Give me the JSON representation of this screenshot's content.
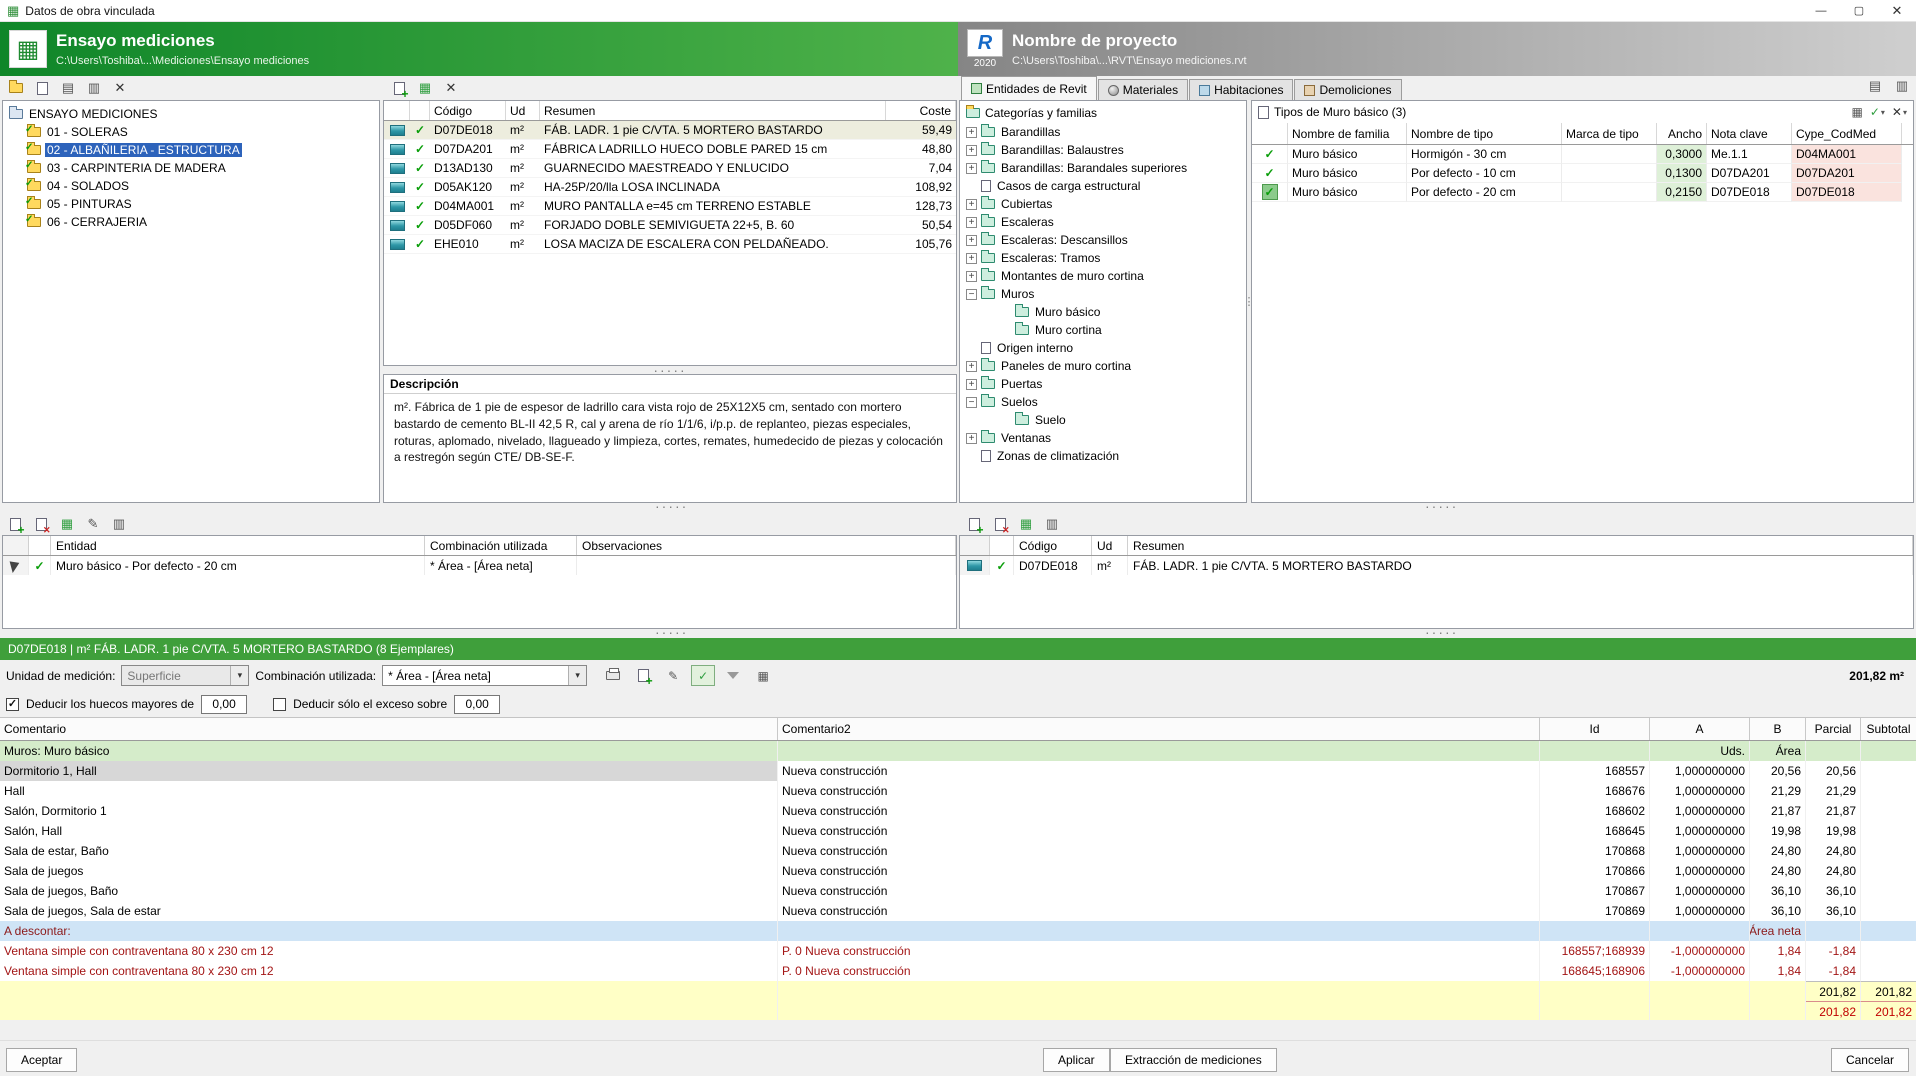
{
  "window": {
    "title": "Datos de obra vinculada"
  },
  "icons": {
    "app": "▦",
    "minimize": "—",
    "maximize": "▢",
    "close": "✕",
    "budget_logo": "▦",
    "grid": "▦",
    "rows": "▤",
    "columns": "▥",
    "cross": "✕",
    "check": "✓",
    "pencil": "✎",
    "dropdown": "▾",
    "dots": "·····",
    "vdots": "⋮"
  },
  "budget": {
    "title": "Ensayo mediciones",
    "path": "C:\\Users\\Toshiba\\...\\Mediciones\\Ensayo mediciones",
    "tree": [
      {
        "label": "ENSAYO MEDICIONES",
        "cls": "root"
      },
      {
        "label": "01 - SOLERAS",
        "cls": "lvl1"
      },
      {
        "label": "02 - ALBAÑILERIA - ESTRUCTURA",
        "cls": "lvl1 selected"
      },
      {
        "label": "03 - CARPINTERIA DE MADERA",
        "cls": "lvl1"
      },
      {
        "label": "04 - SOLADOS",
        "cls": "lvl1"
      },
      {
        "label": "05 - PINTURAS",
        "cls": "lvl1"
      },
      {
        "label": "06 - CERRAJERIA",
        "cls": "lvl1"
      }
    ],
    "concepts": {
      "headers": {
        "codigo": "Código",
        "ud": "Ud",
        "resumen": "Resumen",
        "coste": "Coste"
      },
      "rows": [
        {
          "codigo": "D07DE018",
          "ud": "m²",
          "resumen": "FÁB. LADR. 1 pie C/VTA. 5 MORTERO BASTARDO",
          "coste": "59,49",
          "cls": "selected"
        },
        {
          "codigo": "D07DA201",
          "ud": "m²",
          "resumen": "FÁBRICA LADRILLO HUECO DOBLE PARED 15 cm",
          "coste": "48,80"
        },
        {
          "codigo": "D13AD130",
          "ud": "m²",
          "resumen": "GUARNECIDO MAESTREADO Y ENLUCIDO",
          "coste": "7,04"
        },
        {
          "codigo": "D05AK120",
          "ud": "m²",
          "resumen": "HA-25P/20/lla LOSA INCLINADA",
          "coste": "108,92"
        },
        {
          "codigo": "D04MA001",
          "ud": "m²",
          "resumen": "MURO PANTALLA e=45 cm TERRENO ESTABLE",
          "coste": "128,73"
        },
        {
          "codigo": "D05DF060",
          "ud": "m²",
          "resumen": "FORJADO DOBLE SEMIVIGUETA 22+5, B. 60",
          "coste": "50,54"
        },
        {
          "codigo": "EHE010",
          "ud": "m²",
          "resumen": "LOSA MACIZA DE ESCALERA CON PELDAÑEADO.",
          "coste": "105,76"
        }
      ]
    },
    "descripcion": {
      "title": "Descripción",
      "text": "m². Fábrica de 1 pie de espesor de ladrillo cara vista rojo de 25X12X5 cm, sentado con mortero bastardo de cemento BL-II 42,5 R, cal y arena de río 1/1/6, i/p.p. de replanteo, piezas especiales, roturas, aplomado, nivelado, llagueado y limpieza, cortes, remates, humedecido de piezas y colocación a restregón según CTE/ DB-SE-F."
    },
    "entity_table": {
      "headers": {
        "entidad": "Entidad",
        "combinacion": "Combinación utilizada",
        "observaciones": "Observaciones"
      },
      "rows": [
        {
          "entidad": "Muro básico - Por defecto - 20 cm",
          "combinacion": "* Área - [Área neta]",
          "observaciones": ""
        }
      ]
    }
  },
  "revit": {
    "title": "Nombre de proyecto",
    "logo_letter": "R",
    "logo_year": "2020",
    "path": "C:\\Users\\Toshiba\\...\\RVT\\Ensayo mediciones.rvt",
    "tabs": [
      {
        "label": "Entidades de Revit",
        "cls": "active"
      },
      {
        "label": "Materiales"
      },
      {
        "label": "Habitaciones"
      },
      {
        "label": "Demoliciones"
      }
    ],
    "categories_title": "Categorías y familias",
    "categories": [
      {
        "label": "Barandillas",
        "cls": "exp-plus"
      },
      {
        "label": "Barandillas: Balaustres",
        "cls": "exp-plus"
      },
      {
        "label": "Barandillas: Barandales superiores",
        "cls": "exp-plus"
      },
      {
        "label": "Casos de carga estructural",
        "cls": "exp-none icon-page"
      },
      {
        "label": "Cubiertas",
        "cls": "exp-plus"
      },
      {
        "label": "Escaleras",
        "cls": "exp-plus"
      },
      {
        "label": "Escaleras: Descansillos",
        "cls": "exp-plus"
      },
      {
        "label": "Escaleras: Tramos",
        "cls": "exp-plus"
      },
      {
        "label": "Montantes de muro cortina",
        "cls": "exp-plus"
      },
      {
        "label": "Muros",
        "cls": "exp-minus"
      },
      {
        "label": "Muro básico",
        "cls": "exp-none lvl1"
      },
      {
        "label": "Muro cortina",
        "cls": "exp-none lvl1"
      },
      {
        "label": "Origen interno",
        "cls": "exp-none icon-page"
      },
      {
        "label": "Paneles de muro cortina",
        "cls": "exp-plus"
      },
      {
        "label": "Puertas",
        "cls": "exp-plus"
      },
      {
        "label": "Suelos",
        "cls": "exp-minus"
      },
      {
        "label": "Suelo",
        "cls": "exp-none lvl1"
      },
      {
        "label": "Ventanas",
        "cls": "exp-plus"
      },
      {
        "label": "Zonas de climatización",
        "cls": "exp-none icon-page"
      }
    ],
    "types": {
      "title": "Tipos de Muro básico (3)",
      "headers": {
        "familia": "Nombre de familia",
        "tipo": "Nombre de tipo",
        "marca": "Marca de tipo",
        "ancho": "Ancho",
        "nota": "Nota clave",
        "cype": "Cype_CodMed"
      },
      "rows": [
        {
          "familia": "Muro básico",
          "tipo": "Hormigón - 30 cm",
          "marca": "",
          "ancho": "0,3000",
          "nota": "Me.1.1",
          "cype": "D04MA001"
        },
        {
          "familia": "Muro básico",
          "tipo": "Por defecto - 10 cm",
          "marca": "",
          "ancho": "0,1300",
          "nota": "D07DA201",
          "cype": "D07DA201"
        },
        {
          "familia": "Muro básico",
          "tipo": "Por defecto - 20 cm",
          "marca": "",
          "ancho": "0,2150",
          "nota": "D07DE018",
          "cype": "D07DE018",
          "cls": "check-active"
        }
      ]
    },
    "linked_concept": {
      "headers": {
        "codigo": "Código",
        "ud": "Ud",
        "resumen": "Resumen"
      },
      "rows": [
        {
          "codigo": "D07DE018",
          "ud": "m²",
          "resumen": "FÁB. LADR. 1 pie C/VTA. 5 MORTERO BASTARDO"
        }
      ]
    }
  },
  "measurement": {
    "bar_title": "D07DE018 | m² FÁB. LADR. 1 pie C/VTA. 5 MORTERO BASTARDO (8 Ejemplares)",
    "unit_label": "Unidad de medición:",
    "unit_value": "Superficie",
    "combo_label": "Combinación utilizada:",
    "combo_value": "* Área - [Área neta]",
    "total_display": "201,82 m²",
    "deduct1": {
      "label": "Deducir los huecos mayores de",
      "value": "0,00",
      "checked": true
    },
    "deduct2": {
      "label": "Deducir sólo el exceso sobre",
      "value": "0,00",
      "checked": false
    },
    "table": {
      "headers": {
        "comentario": "Comentario",
        "comentario2": "Comentario2",
        "id": "Id",
        "a": "A",
        "b": "B",
        "parcial": "Parcial",
        "subtotal": "Subtotal"
      },
      "group": {
        "comentario": "Muros: Muro básico",
        "a": "Uds.",
        "b": "Área"
      },
      "rows": [
        {
          "comentario": "Dormitorio 1, Hall",
          "comentario2": "Nueva construcción",
          "id": "168557",
          "a": "1,000000000",
          "b": "20,56",
          "parcial": "20,56",
          "cls": "selected"
        },
        {
          "comentario": "Hall",
          "comentario2": "Nueva construcción",
          "id": "168676",
          "a": "1,000000000",
          "b": "21,29",
          "parcial": "21,29"
        },
        {
          "comentario": "Salón, Dormitorio 1",
          "comentario2": "Nueva construcción",
          "id": "168602",
          "a": "1,000000000",
          "b": "21,87",
          "parcial": "21,87"
        },
        {
          "comentario": "Salón, Hall",
          "comentario2": "Nueva construcción",
          "id": "168645",
          "a": "1,000000000",
          "b": "19,98",
          "parcial": "19,98"
        },
        {
          "comentario": "Sala de estar, Baño",
          "comentario2": "Nueva construcción",
          "id": "170868",
          "a": "1,000000000",
          "b": "24,80",
          "parcial": "24,80"
        },
        {
          "comentario": "Sala de juegos",
          "comentario2": "Nueva construcción",
          "id": "170866",
          "a": "1,000000000",
          "b": "24,80",
          "parcial": "24,80"
        },
        {
          "comentario": "Sala de juegos, Baño",
          "comentario2": "Nueva construcción",
          "id": "170867",
          "a": "1,000000000",
          "b": "36,10",
          "parcial": "36,10"
        },
        {
          "comentario": "Sala de juegos, Sala de estar",
          "comentario2": "Nueva construcción",
          "id": "170869",
          "a": "1,000000000",
          "b": "36,10",
          "parcial": "36,10"
        }
      ],
      "descontar": {
        "comentario": "A descontar:",
        "b": "Área neta"
      },
      "deductions": [
        {
          "comentario": "Ventana simple con contraventana 80 x 230 cm 12",
          "comentario2": "P. 0 Nueva construcción",
          "id": "168557;168939",
          "a": "-1,000000000",
          "b": "1,84",
          "parcial": "-1,84"
        },
        {
          "comentario": "Ventana simple con contraventana 80 x 230 cm 12",
          "comentario2": "P. 0 Nueva construcción",
          "id": "168645;168906",
          "a": "-1,000000000",
          "b": "1,84",
          "parcial": "-1,84"
        }
      ],
      "total1": {
        "parcial": "201,82",
        "subtotal": "201,82"
      },
      "total2": {
        "parcial": "201,82",
        "subtotal": "201,82"
      }
    }
  },
  "footer": {
    "accept": "Aceptar",
    "apply": "Aplicar",
    "extract": "Extracción de mediciones",
    "cancel": "Cancelar"
  }
}
